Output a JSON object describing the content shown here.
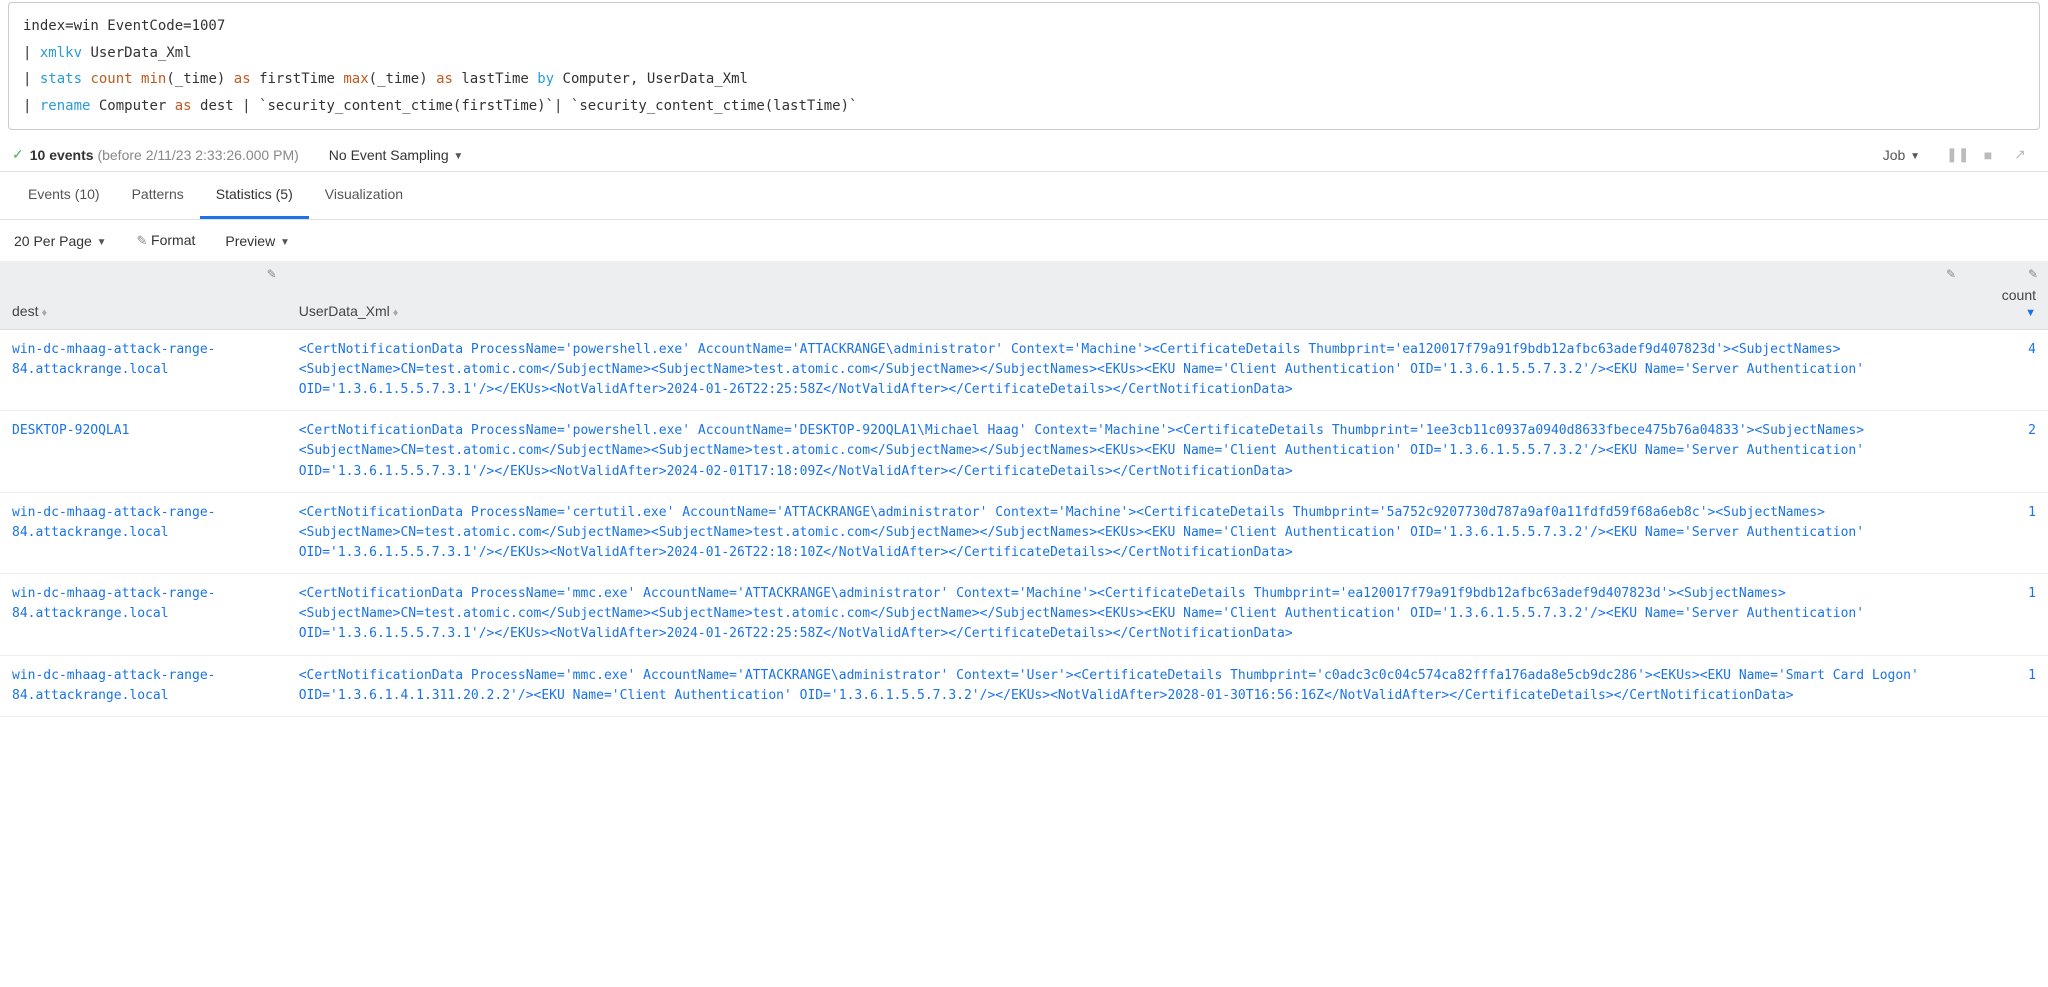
{
  "search_query": {
    "line1_prefix": "index=win EventCode=1007",
    "line2_pipe": "| ",
    "line2_kw": "xmlkv",
    "line2_rest": " UserData_Xml",
    "line3_pipe": "| ",
    "line3_stats": "stats",
    "line3_sp1": " ",
    "line3_count": "count",
    "line3_sp2": " ",
    "line3_min": "min",
    "line3_arg1": "(_time) ",
    "line3_as1": "as",
    "line3_mid1": " firstTime ",
    "line3_max": "max",
    "line3_arg2": "(_time) ",
    "line3_as2": "as",
    "line3_mid2": " lastTime ",
    "line3_by": "by",
    "line3_rest": " Computer, UserData_Xml",
    "line4_pipe": "| ",
    "line4_rename": "rename",
    "line4_mid1": " Computer ",
    "line4_as": "as",
    "line4_rest": " dest | `security_content_ctime(firstTime)`| `security_content_ctime(lastTime)`"
  },
  "status": {
    "event_count": "10 events",
    "timerange": " (before 2/11/23 2:33:26.000 PM)",
    "sampling_label": "No Event Sampling",
    "job_label": "Job"
  },
  "tabs": {
    "events": "Events (10)",
    "patterns": "Patterns",
    "statistics": "Statistics (5)",
    "visualization": "Visualization"
  },
  "controls": {
    "perpage": "20 Per Page",
    "format": "Format",
    "preview": "Preview"
  },
  "columns": {
    "dest": "dest",
    "xml": "UserData_Xml",
    "count": "count"
  },
  "rows": [
    {
      "dest": "win-dc-mhaag-attack-range-84.attackrange.local",
      "xml": "<CertNotificationData ProcessName='powershell.exe' AccountName='ATTACKRANGE\\administrator' Context='Machine'><CertificateDetails Thumbprint='ea120017f79a91f9bdb12afbc63adef9d407823d'><SubjectNames><SubjectName>CN=test.atomic.com</SubjectName><SubjectName>test.atomic.com</SubjectName></SubjectNames><EKUs><EKU Name='Client Authentication' OID='1.3.6.1.5.5.7.3.2'/><EKU Name='Server Authentication' OID='1.3.6.1.5.5.7.3.1'/></EKUs><NotValidAfter>2024-01-26T22:25:58Z</NotValidAfter></CertificateDetails></CertNotificationData>",
      "count": "4"
    },
    {
      "dest": "DESKTOP-92OQLA1",
      "xml": "<CertNotificationData ProcessName='powershell.exe' AccountName='DESKTOP-92OQLA1\\Michael Haag' Context='Machine'><CertificateDetails Thumbprint='1ee3cb11c0937a0940d8633fbece475b76a04833'><SubjectNames><SubjectName>CN=test.atomic.com</SubjectName><SubjectName>test.atomic.com</SubjectName></SubjectNames><EKUs><EKU Name='Client Authentication' OID='1.3.6.1.5.5.7.3.2'/><EKU Name='Server Authentication' OID='1.3.6.1.5.5.7.3.1'/></EKUs><NotValidAfter>2024-02-01T17:18:09Z</NotValidAfter></CertificateDetails></CertNotificationData>",
      "count": "2"
    },
    {
      "dest": "win-dc-mhaag-attack-range-84.attackrange.local",
      "xml": "<CertNotificationData ProcessName='certutil.exe' AccountName='ATTACKRANGE\\administrator' Context='Machine'><CertificateDetails Thumbprint='5a752c9207730d787a9af0a11fdfd59f68a6eb8c'><SubjectNames><SubjectName>CN=test.atomic.com</SubjectName><SubjectName>test.atomic.com</SubjectName></SubjectNames><EKUs><EKU Name='Client Authentication' OID='1.3.6.1.5.5.7.3.2'/><EKU Name='Server Authentication' OID='1.3.6.1.5.5.7.3.1'/></EKUs><NotValidAfter>2024-01-26T22:18:10Z</NotValidAfter></CertificateDetails></CertNotificationData>",
      "count": "1"
    },
    {
      "dest": "win-dc-mhaag-attack-range-84.attackrange.local",
      "xml": "<CertNotificationData ProcessName='mmc.exe' AccountName='ATTACKRANGE\\administrator' Context='Machine'><CertificateDetails Thumbprint='ea120017f79a91f9bdb12afbc63adef9d407823d'><SubjectNames><SubjectName>CN=test.atomic.com</SubjectName><SubjectName>test.atomic.com</SubjectName></SubjectNames><EKUs><EKU Name='Client Authentication' OID='1.3.6.1.5.5.7.3.2'/><EKU Name='Server Authentication' OID='1.3.6.1.5.5.7.3.1'/></EKUs><NotValidAfter>2024-01-26T22:25:58Z</NotValidAfter></CertificateDetails></CertNotificationData>",
      "count": "1"
    },
    {
      "dest": "win-dc-mhaag-attack-range-84.attackrange.local",
      "xml": "<CertNotificationData ProcessName='mmc.exe' AccountName='ATTACKRANGE\\administrator' Context='User'><CertificateDetails Thumbprint='c0adc3c0c04c574ca82fffa176ada8e5cb9dc286'><EKUs><EKU Name='Smart Card Logon' OID='1.3.6.1.4.1.311.20.2.2'/><EKU Name='Client Authentication' OID='1.3.6.1.5.5.7.3.2'/></EKUs><NotValidAfter>2028-01-30T16:56:16Z</NotValidAfter></CertificateDetails></CertNotificationData>",
      "count": "1"
    }
  ]
}
